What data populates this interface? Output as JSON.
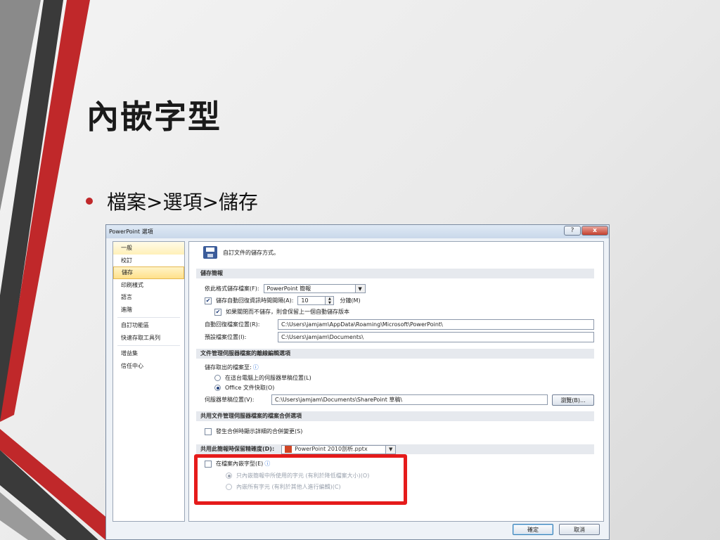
{
  "slide": {
    "title": "內嵌字型",
    "bullet": "檔案>選項>儲存"
  },
  "colors": {
    "stripe_red": "#c0282a",
    "stripe_dark": "#3a3a3a",
    "highlight": "#e51b1b"
  },
  "dialog": {
    "title": "PowerPoint 選項",
    "help_label": "?",
    "close_label": "x",
    "nav": [
      "一般",
      "校訂",
      "儲存",
      "印刷樣式",
      "語言",
      "進階",
      "自訂功能區",
      "快速存取工具列",
      "增益集",
      "信任中心"
    ],
    "header_text": "自訂文件的儲存方式。",
    "save_presentations": {
      "heading": "儲存簡報",
      "format_label": "依此格式儲存檔案(F):",
      "format_value": "PowerPoint 簡報",
      "autorecover_label": "儲存自動回復資訊時間間隔(A):",
      "autorecover_value": "10",
      "minutes_label": "分鐘(M)",
      "keep_last_label": "如果關閉而不儲存，則會保留上一個自動儲存版本",
      "autorecover_loc_label": "自動回復檔案位置(R):",
      "autorecover_loc_value": "C:\\Users\\jamjam\\AppData\\Roaming\\Microsoft\\PowerPoint\\",
      "default_loc_label": "預設檔案位置(I):",
      "default_loc_value": "C:\\Users\\jamjam\\Documents\\"
    },
    "offline": {
      "heading": "文件管理伺服器檔案的離線編輯選項",
      "save_to_label": "儲存取出的檔案至:",
      "option_server": "在這台電腦上的伺服器草稿位置(L)",
      "option_cache": "Office 文件快取(O)",
      "drafts_label": "伺服器草稿位置(V):",
      "drafts_value": "C:\\Users\\jamjam\\Documents\\SharePoint 草稿\\",
      "browse_label": "瀏覽(B)..."
    },
    "merge": {
      "heading": "共用文件管理伺服器檔案的檔案合併選項",
      "show_changes_label": "發生合併時顯示詳細的合併變更(S)"
    },
    "fidelity": {
      "heading": "共用此簡報時保留精確度(D):",
      "presentation_value": "PowerPoint 2010剖析.pptx",
      "embed_label": "在檔案內嵌字型(E)",
      "embed_used_label": "只內嵌簡報中所使用的字元 (有利於降低檔案大小)(O)",
      "embed_all_label": "內嵌所有字元 (有利於其他人進行編輯)(C)"
    },
    "ok_label": "確定",
    "cancel_label": "取消"
  }
}
